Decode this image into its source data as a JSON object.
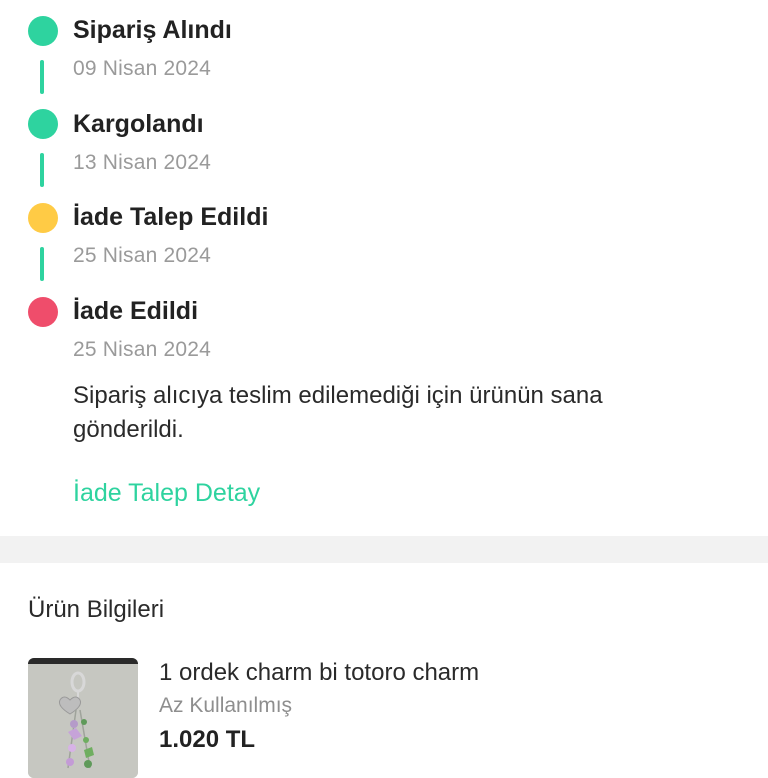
{
  "timeline": {
    "steps": [
      {
        "title": "Sipariş Alındı",
        "date": "09 Nisan 2024",
        "status_color": "#2ed39f"
      },
      {
        "title": "Kargolandı",
        "date": "13 Nisan 2024",
        "status_color": "#2ed39f"
      },
      {
        "title": "İade Talep Edildi",
        "date": "25 Nisan 2024",
        "status_color": "#ffcb45"
      },
      {
        "title": "İade Edildi",
        "date": "25 Nisan 2024",
        "status_color": "#ef4d6b"
      }
    ],
    "note": "Sipariş alıcıya teslim edilemediği için ürünün sana gönderildi.",
    "detail_link": "İade Talep Detay",
    "accent_color": "#2ed39f"
  },
  "product_info": {
    "section_title": "Ürün Bilgileri",
    "name": "1 ordek charm bi totoro charm",
    "condition": "Az Kullanılmış",
    "price": "1.020 TL",
    "thumbnail_icon": "product-photo"
  }
}
